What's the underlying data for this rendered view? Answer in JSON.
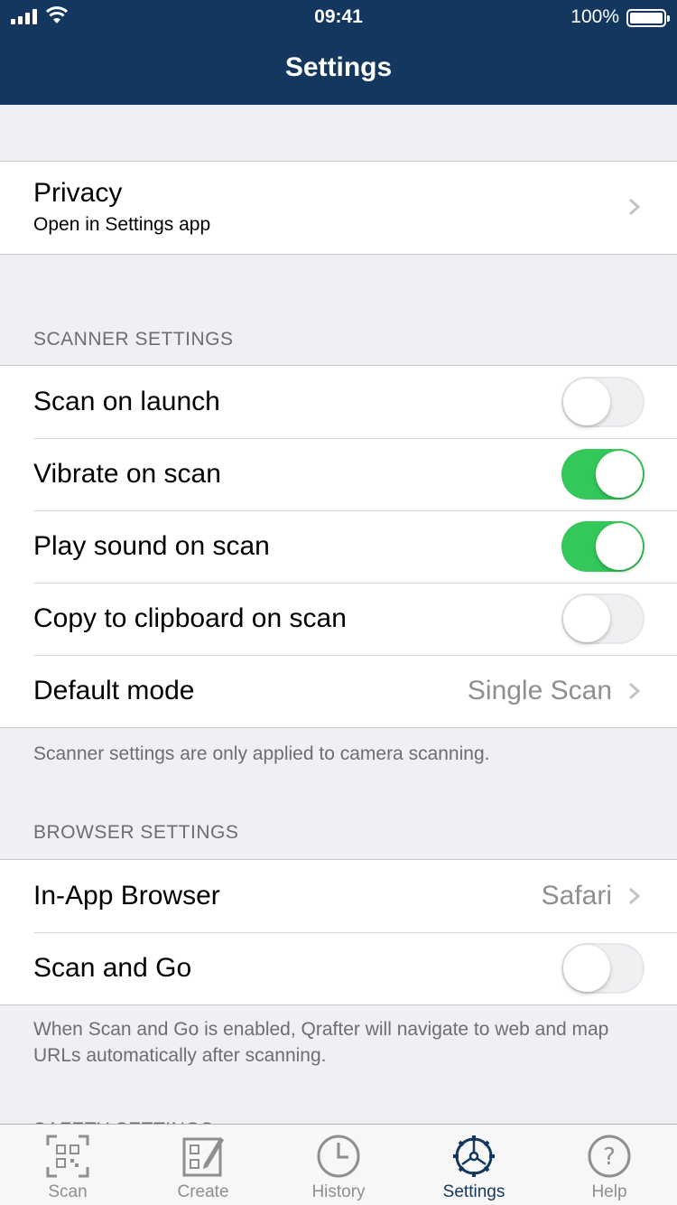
{
  "status_bar": {
    "time": "09:41",
    "battery": "100%"
  },
  "nav": {
    "title": "Settings"
  },
  "privacy": {
    "title": "Privacy",
    "subtitle": "Open in Settings app"
  },
  "scanner": {
    "header": "SCANNER SETTINGS",
    "rows": [
      {
        "label": "Scan on launch",
        "on": false
      },
      {
        "label": "Vibrate on scan",
        "on": true
      },
      {
        "label": "Play sound on scan",
        "on": true
      },
      {
        "label": "Copy to clipboard on scan",
        "on": false
      }
    ],
    "default_mode": {
      "label": "Default mode",
      "value": "Single Scan"
    },
    "footer": "Scanner settings are only applied to camera scanning."
  },
  "browser": {
    "header": "BROWSER SETTINGS",
    "in_app": {
      "label": "In-App Browser",
      "value": "Safari"
    },
    "scan_and_go": {
      "label": "Scan and Go",
      "on": false
    },
    "footer": "When Scan and Go is enabled, Qrafter will navigate to web and map URLs automatically after scanning."
  },
  "safety": {
    "header": "SAFETY SETTINGS"
  },
  "colors": {
    "nav_bg": "#13375e",
    "toggle_on": "#34c759",
    "tab_active": "#13375e",
    "tab_inactive": "#8e8e93"
  },
  "tabs": [
    {
      "label": "Scan",
      "icon": "qr-scan-icon",
      "active": false
    },
    {
      "label": "Create",
      "icon": "create-qr-icon",
      "active": false
    },
    {
      "label": "History",
      "icon": "clock-icon",
      "active": false
    },
    {
      "label": "Settings",
      "icon": "gear-icon",
      "active": true
    },
    {
      "label": "Help",
      "icon": "help-icon",
      "active": false
    }
  ]
}
